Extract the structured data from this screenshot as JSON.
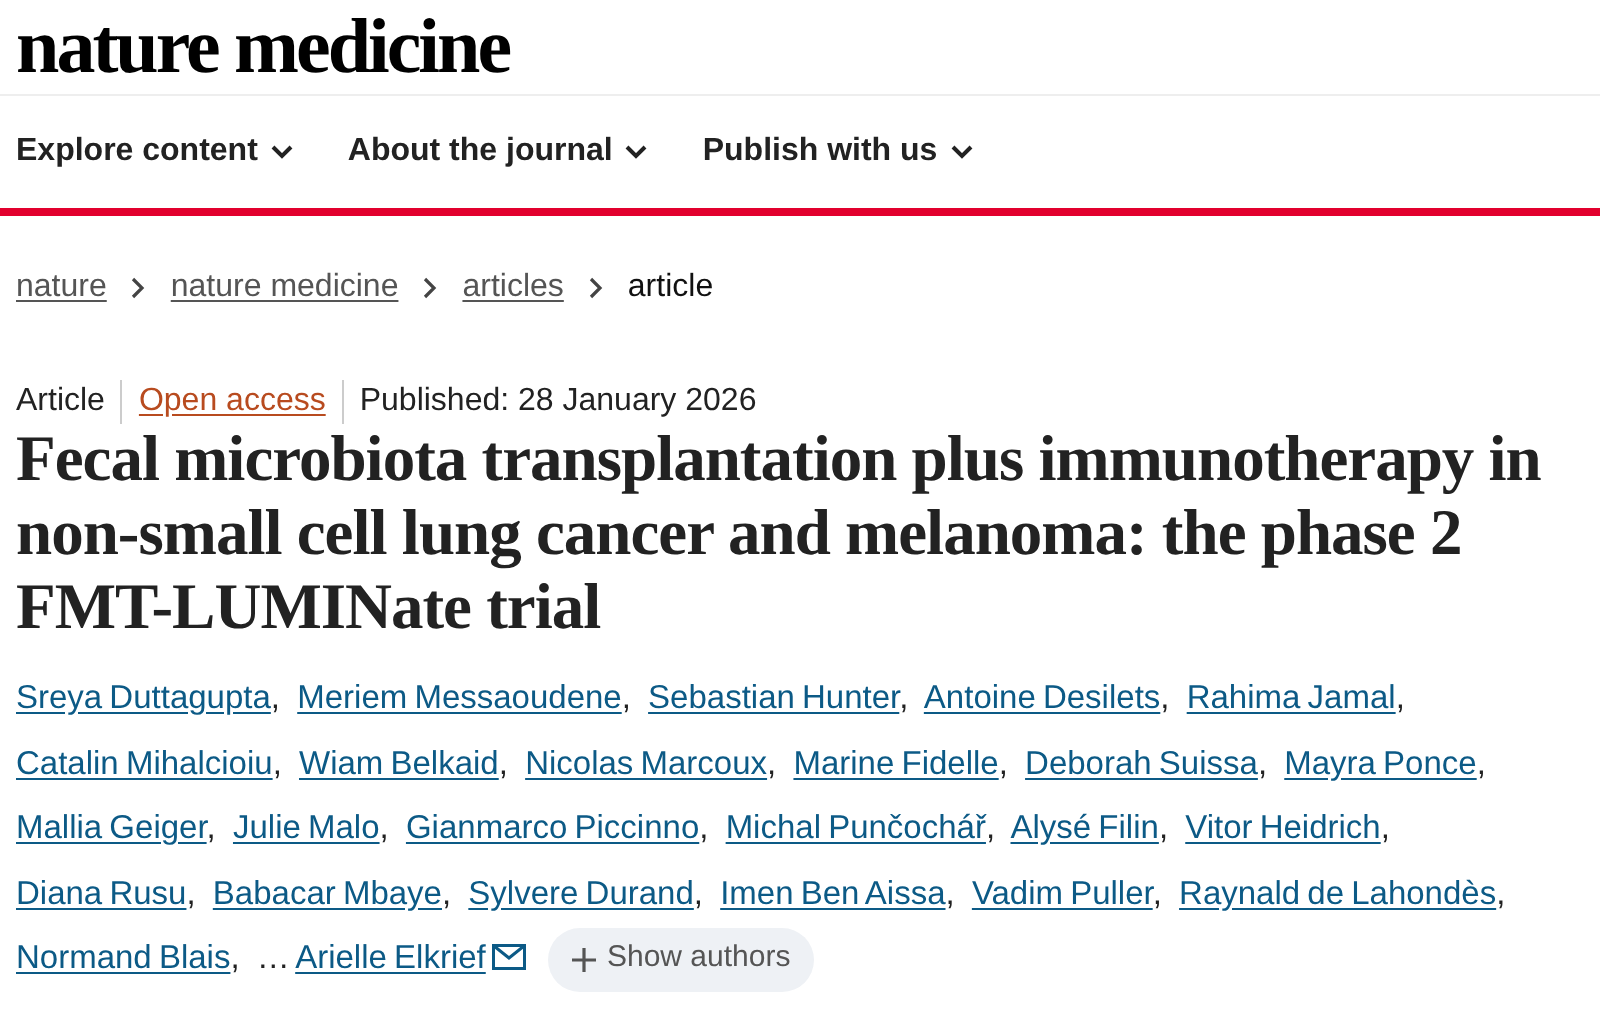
{
  "logo": "nature medicine",
  "nav": [
    {
      "label": "Explore content"
    },
    {
      "label": "About the journal"
    },
    {
      "label": "Publish with us"
    }
  ],
  "breadcrumbs": [
    {
      "label": "nature",
      "link": true
    },
    {
      "label": "nature medicine",
      "link": true
    },
    {
      "label": "articles",
      "link": true
    },
    {
      "label": "article",
      "link": false
    }
  ],
  "meta": {
    "type": "Article",
    "access": "Open access",
    "published": "Published: 28 January 2026"
  },
  "title": "Fecal microbiota transplantation plus immunotherapy in non-small cell lung cancer and melanoma: the phase 2 FMT-LUMINate trial",
  "authors": [
    "Sreya Duttagupta",
    "Meriem Messaoudene",
    "Sebastian Hunter",
    "Antoine Desilets",
    "Rahima Jamal",
    "Catalin Mihalcioiu",
    "Wiam Belkaid",
    "Nicolas Marcoux",
    "Marine Fidelle",
    "Deborah Suissa",
    "Mayra Ponce",
    "Mallia Geiger",
    "Julie Malo",
    "Gianmarco Piccinno",
    "Michal Punčochář",
    "Alysé Filin",
    "Vitor Heidrich",
    "Diana Rusu",
    "Babacar Mbaye",
    "Sylvere Durand",
    "Imen Ben Aissa",
    "Vadim Puller",
    "Raynald de Lahondès",
    "Normand Blais"
  ],
  "separator": ",",
  "ellipsis": "…",
  "last_author": {
    "name": "Arielle Elkrief",
    "email": true
  },
  "show_authors": "Show authors"
}
